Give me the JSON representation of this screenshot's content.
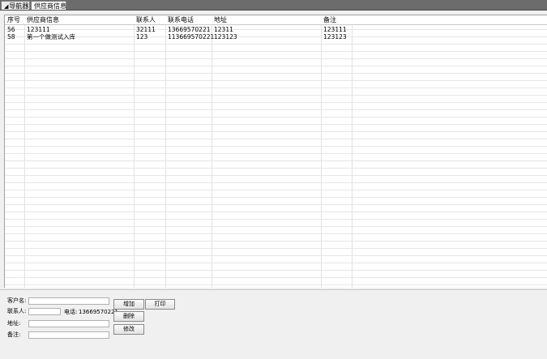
{
  "tabs": {
    "nav_label": "导航器",
    "active_label": "供应商信息"
  },
  "table": {
    "headers": [
      "序号",
      "供应商信息",
      "联系人",
      "联系电话",
      "地址",
      "备注"
    ],
    "rows": [
      [
        "56",
        "123111",
        "32111",
        "13669570221",
        "12311",
        "123111"
      ],
      [
        "58",
        "第一个做测试入库",
        "123",
        "113669570221",
        "123123",
        "123123"
      ]
    ]
  },
  "form": {
    "customer_label": "客户名:",
    "customer_value": "",
    "contact_label": "联系人:",
    "contact_value": "",
    "phone_label": "电话:",
    "phone_value": "13669570221",
    "address_label": "地址:",
    "address_value": "",
    "remark_label": "备注:",
    "remark_value": ""
  },
  "buttons": {
    "add": "增加",
    "print": "打印",
    "delete": "删除",
    "modify": "修改"
  }
}
